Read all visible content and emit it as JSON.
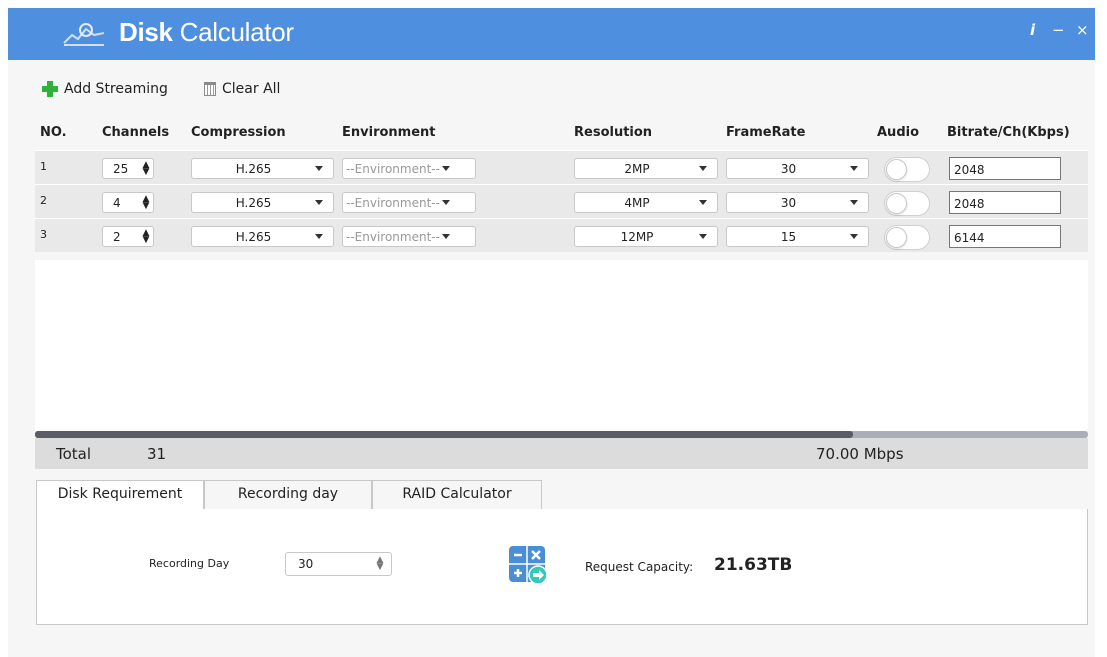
{
  "app": {
    "title_bold": "Disk",
    "title_light": "Calculator"
  },
  "window_controls": {
    "info": "i",
    "minimize": "−",
    "close": "×"
  },
  "toolbar": {
    "add_label": "Add Streaming",
    "clear_label": "Clear All"
  },
  "table": {
    "headers": {
      "no": "NO.",
      "channels": "Channels",
      "compression": "Compression",
      "environment": "Environment",
      "resolution": "Resolution",
      "framerate": "FrameRate",
      "audio": "Audio",
      "bitrate": "Bitrate/Ch(Kbps)"
    },
    "rows": [
      {
        "no": "1",
        "channels": "25",
        "compression": "H.265",
        "environment": "--Environment--",
        "resolution": "2MP",
        "framerate": "30",
        "audio": false,
        "bitrate": "2048"
      },
      {
        "no": "2",
        "channels": "4",
        "compression": "H.265",
        "environment": "--Environment--",
        "resolution": "4MP",
        "framerate": "30",
        "audio": false,
        "bitrate": "2048"
      },
      {
        "no": "3",
        "channels": "2",
        "compression": "H.265",
        "environment": "--Environment--",
        "resolution": "12MP",
        "framerate": "15",
        "audio": false,
        "bitrate": "6144"
      }
    ]
  },
  "total": {
    "label": "Total",
    "channels": "31",
    "bandwidth": "70.00 Mbps"
  },
  "tabs": [
    {
      "label": "Disk Requirement",
      "active": true
    },
    {
      "label": "Recording day",
      "active": false
    },
    {
      "label": "RAID Calculator",
      "active": false
    }
  ],
  "disk_requirement": {
    "recording_day_label": "Recording Day",
    "recording_day_value": "30",
    "request_capacity_label": "Request Capacity:",
    "request_capacity_value": "21.63TB"
  },
  "icons": [
    "logo-icon",
    "plus-icon",
    "trash-icon",
    "spinner-arrows-icon",
    "dropdown-caret-icon",
    "toggle-switch",
    "calculator-icon"
  ],
  "colors": {
    "title_bar": "#4f8fe0",
    "add_icon": "#2fb23c",
    "row_bg": "#e9e9e9",
    "calc_icon": "#4a8fd6",
    "calc_arrow": "#32c9b8"
  }
}
